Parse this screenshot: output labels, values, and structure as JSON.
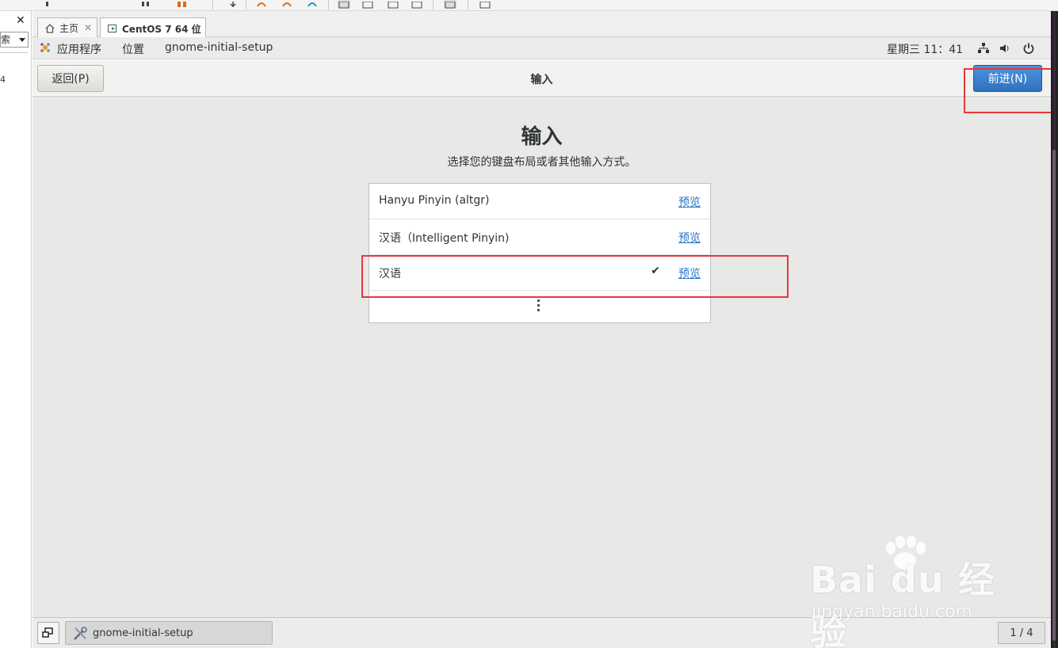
{
  "host": {
    "sidebar_combo": "索",
    "sidebar_frag": "4"
  },
  "tabs": [
    {
      "label": "主页"
    },
    {
      "label": "CentOS 7 64 位"
    }
  ],
  "gnome_bar": {
    "applications": "应用程序",
    "places": "位置",
    "app_name": "gnome-initial-setup",
    "clock": "星期三 11：41"
  },
  "headerbar": {
    "back_label": "返回(P)",
    "title": "输入",
    "next_label": "前进(N)"
  },
  "page": {
    "heading": "输入",
    "subtitle": "选择您的键盘布局或者其他输入方式。"
  },
  "input_sources": [
    {
      "name": "Hanyu Pinyin (altgr)",
      "preview": "预览",
      "selected": false
    },
    {
      "name": "汉语（Intelligent Pinyin)",
      "preview": "预览",
      "selected": false
    },
    {
      "name": "汉语",
      "preview": "预览",
      "selected": true,
      "check": "✔"
    }
  ],
  "taskbar": {
    "window_label": "gnome-initial-setup",
    "pager": "1 / 4"
  },
  "watermark": {
    "main": "Bai du 经验",
    "sub": "jingyan.baidu.com"
  },
  "colors": {
    "accent_button": "#3b82cc",
    "link": "#2a76c6",
    "highlight": "#e4393c",
    "content_bg": "#e8e8e7"
  }
}
